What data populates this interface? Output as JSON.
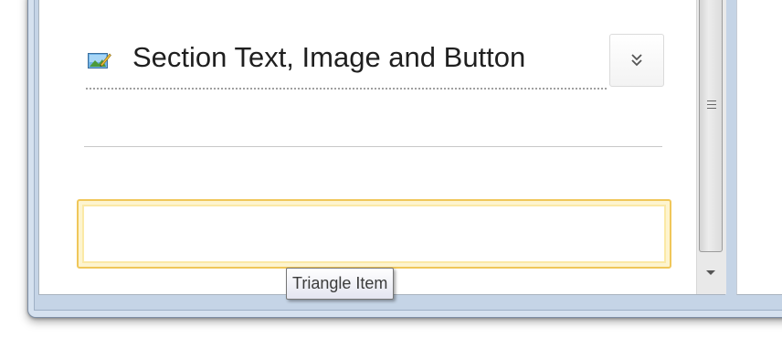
{
  "section": {
    "title": "Section Text, Image and Button",
    "icon": "text-image-section-icon"
  },
  "collapse_button": {
    "icon": "double-chevron-down-icon"
  },
  "tooltip": {
    "text": "Triangle Item"
  },
  "colors": {
    "field_border": "#f0c75a",
    "window_frame": "#c5d4e6"
  }
}
